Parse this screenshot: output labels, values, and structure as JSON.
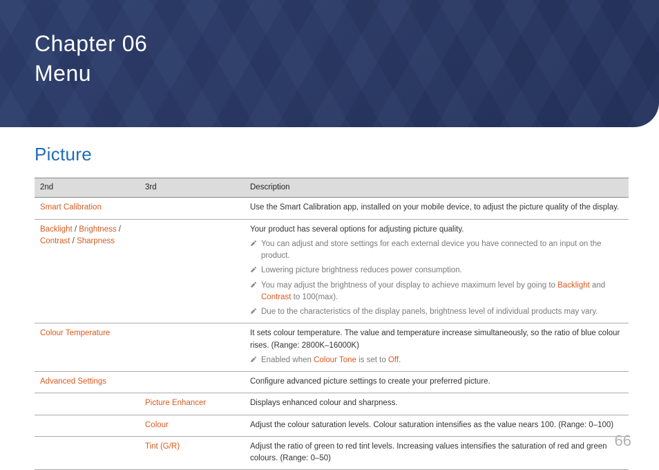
{
  "banner": {
    "line1": "Chapter 06",
    "line2": "Menu"
  },
  "section_title": "Picture",
  "headers": {
    "c1": "2nd",
    "c2": "3rd",
    "c3": "Description"
  },
  "rows": {
    "smart_calib": {
      "c1": "Smart Calibration",
      "desc": "Use the Smart Calibration app, installed on your mobile device, to adjust the picture quality of the display."
    },
    "backlight_group": {
      "t1": "Backlight",
      "t2": "Brightness",
      "t3": "Contrast",
      "t4": "Sharpness",
      "intro": "Your product has several options for adjusting picture quality.",
      "n1": "You can adjust and store settings for each external device you have connected to an input on the product.",
      "n2": "Lowering picture brightness reduces power consumption.",
      "n3a": "You may adjust the brightness of your display to achieve maximum level by going to ",
      "n3_bl": "Backlight",
      "n3_and": " and ",
      "n3_ct": "Contrast",
      "n3b": " to 100(max).",
      "n4": "Due to the characteristics of the display panels, brightness level of individual products may vary."
    },
    "colour_temp": {
      "c1": "Colour Temperature",
      "desc": "It sets colour temperature. The value and temperature increase simultaneously, so the ratio of blue colour rises. (Range: 2800K–16000K)",
      "note_a": "Enabled when ",
      "note_tone": "Colour Tone",
      "note_mid": " is set to ",
      "note_off": "Off",
      "note_end": "."
    },
    "adv": {
      "c1": "Advanced Settings",
      "desc": "Configure advanced picture settings to create your preferred picture.",
      "r1_c2": "Picture Enhancer",
      "r1_desc": "Displays enhanced colour and sharpness.",
      "r2_c2": "Colour",
      "r2_desc": "Adjust the colour saturation levels. Colour saturation intensifies as the value nears 100. (Range: 0–100)",
      "r3_c2": "Tint (G/R)",
      "r3_desc": "Adjust the ratio of green to red tint levels. Increasing values intensifies the saturation of red and green colours. (Range: 0–50)"
    }
  },
  "page_number": "66"
}
